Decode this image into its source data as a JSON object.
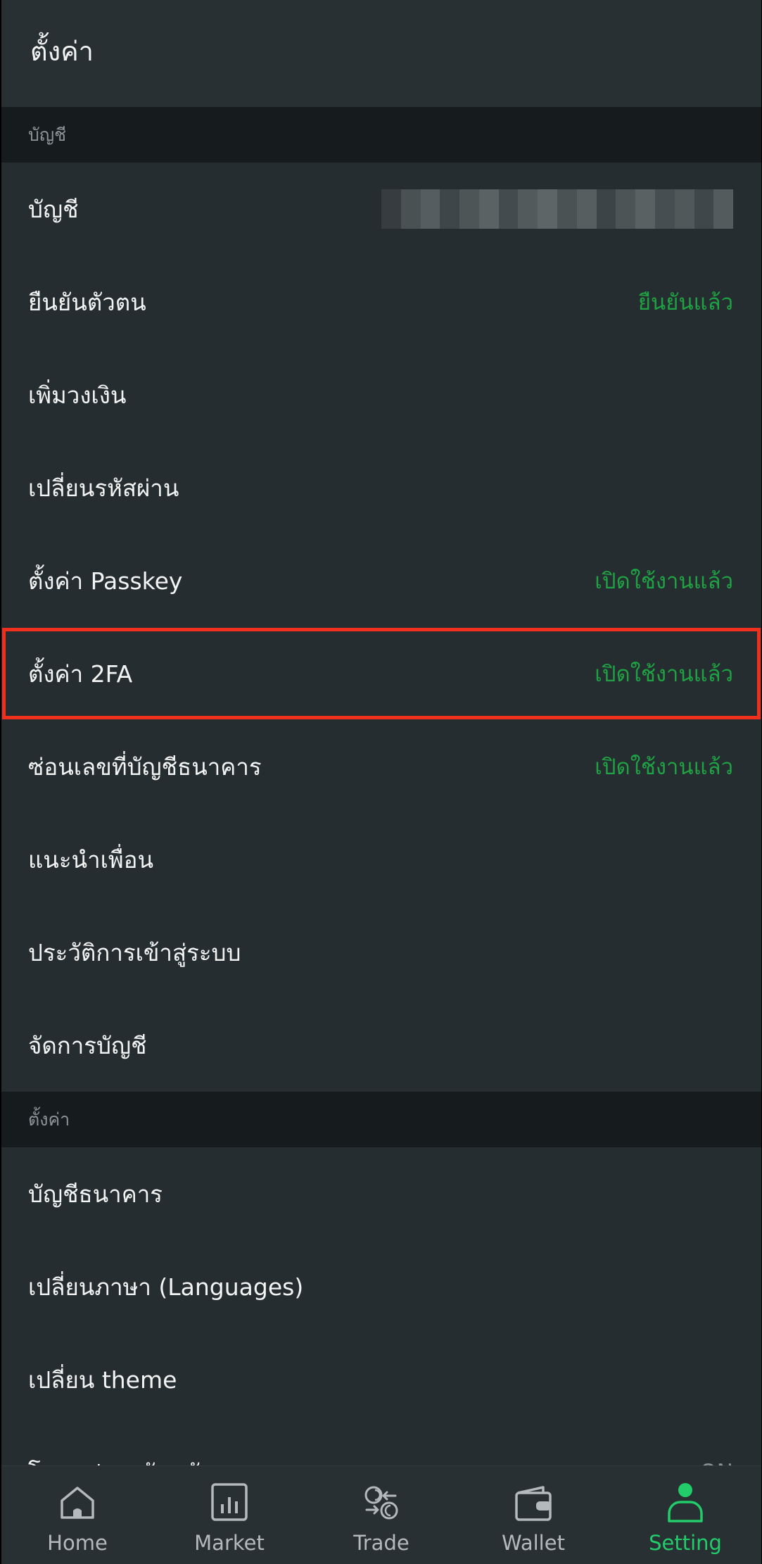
{
  "header": {
    "title": "ตั้งค่า"
  },
  "sections": {
    "account": {
      "title": "บัญชี",
      "items": [
        {
          "label": "บัญชี",
          "value": ""
        },
        {
          "label": "ยืนยันตัวตน",
          "value": "ยืนยันแล้ว"
        },
        {
          "label": "เพิ่มวงเงิน",
          "value": ""
        },
        {
          "label": "เปลี่ยนรหัสผ่าน",
          "value": ""
        },
        {
          "label": "ตั้งค่า Passkey",
          "value": "เปิดใช้งานแล้ว"
        },
        {
          "label": "ตั้งค่า 2FA",
          "value": "เปิดใช้งานแล้ว"
        },
        {
          "label": "ซ่อนเลขที่บัญชีธนาคาร",
          "value": "เปิดใช้งานแล้ว"
        },
        {
          "label": "แนะนำเพื่อน",
          "value": ""
        },
        {
          "label": "ประวัติการเข้าสู่ระบบ",
          "value": ""
        },
        {
          "label": "จัดการบัญชี",
          "value": ""
        }
      ]
    },
    "settings": {
      "title": "ตั้งค่า",
      "items": [
        {
          "label": "บัญชีธนาคาร",
          "value": ""
        },
        {
          "label": "เปลี่ยนภาษา (Languages)",
          "value": ""
        },
        {
          "label": "เปลี่ยน theme",
          "value": ""
        },
        {
          "label": "โหมดประหยัดพลังงาน",
          "value": "ON"
        }
      ]
    }
  },
  "bottom_nav": {
    "items": [
      {
        "label": "Home",
        "icon": "home-icon"
      },
      {
        "label": "Market",
        "icon": "chart-icon"
      },
      {
        "label": "Trade",
        "icon": "exchange-icon"
      },
      {
        "label": "Wallet",
        "icon": "wallet-icon"
      },
      {
        "label": "Setting",
        "icon": "user-icon"
      }
    ],
    "active": "Setting"
  },
  "colors": {
    "background": "#262d30",
    "header": "#293033",
    "section_header": "#161b1d",
    "text": "#f2f4f4",
    "status_green": "#1fa243",
    "nav_active": "#22cc6a",
    "nav_inactive": "#b3b9bc",
    "highlight_border": "#f0301c"
  }
}
